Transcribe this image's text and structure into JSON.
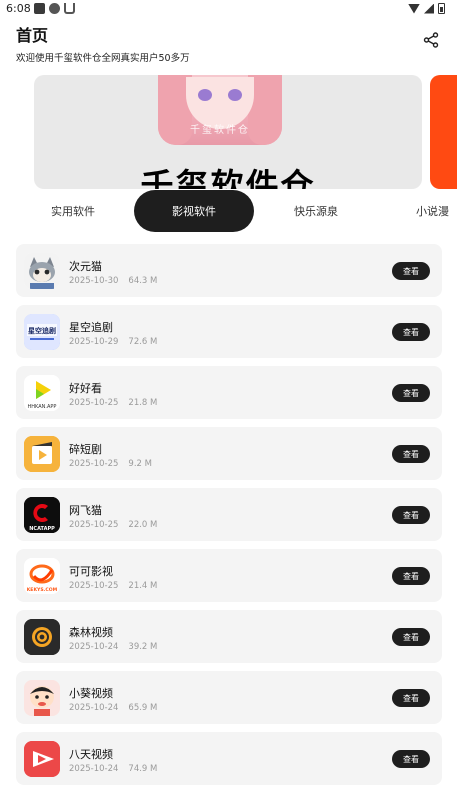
{
  "status_bar": {
    "time": "6:08"
  },
  "header": {
    "title": "首页",
    "subtitle": "欢迎使用千玺软件仓全网真实用户50多万"
  },
  "banner": {
    "image_text": "千玺软件仓",
    "watermark": "千玺软件仓"
  },
  "tabs": [
    {
      "label": "实用软件",
      "active": false
    },
    {
      "label": "影视软件",
      "active": true
    },
    {
      "label": "快乐源泉",
      "active": false
    },
    {
      "label": "小说漫",
      "active": false
    }
  ],
  "apps": [
    {
      "name": "次元猫",
      "date": "2025-10-30",
      "size": "64.3 M",
      "icon": "cat-anime-icon",
      "button": "查看"
    },
    {
      "name": "星空追剧",
      "date": "2025-10-29",
      "size": "72.6 M",
      "icon": "xingkong-icon",
      "button": "查看"
    },
    {
      "name": "好好看",
      "date": "2025-10-25",
      "size": "21.8 M",
      "icon": "hhkan-play-icon",
      "button": "查看",
      "icon_label": "HHKAN.APP"
    },
    {
      "name": "碎短剧",
      "date": "2025-10-25",
      "size": "9.2 M",
      "icon": "short-drama-icon",
      "button": "查看"
    },
    {
      "name": "网飞猫",
      "date": "2025-10-25",
      "size": "22.0 M",
      "icon": "ncat-icon",
      "button": "查看",
      "icon_label": "NCATAPP"
    },
    {
      "name": "可可影视",
      "date": "2025-10-25",
      "size": "21.4 M",
      "icon": "keke-icon",
      "button": "查看",
      "icon_label": "KEKYS.COM"
    },
    {
      "name": "森林视频",
      "date": "2025-10-24",
      "size": "39.2 M",
      "icon": "forest-icon",
      "button": "查看"
    },
    {
      "name": "小葵视频",
      "date": "2025-10-24",
      "size": "65.9 M",
      "icon": "xiaokui-icon",
      "button": "查看"
    },
    {
      "name": "八天视频",
      "date": "2025-10-24",
      "size": "74.9 M",
      "icon": "batian-play-icon",
      "button": "查看"
    }
  ],
  "colors": {
    "accent_dark": "#1e1e1e",
    "banner_next": "#ff4a12",
    "row_bg": "#f4f4f4"
  }
}
